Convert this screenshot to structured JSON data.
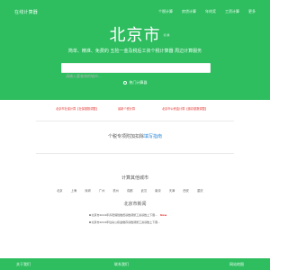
{
  "header": {
    "brand": "在线计算器",
    "nav": [
      "个税计算",
      "房贷计算",
      "年终奖",
      "工资计算",
      "更多"
    ]
  },
  "hero": {
    "title": "北京市",
    "title_suffix": "切换",
    "subtitle": "简单、精准、免费的 五险一金及税后工资个税计算器 周边计算服务",
    "search_placeholder": "请输入要查询的城市...",
    "tip": "热门计算器"
  },
  "promos": [
    "北京市社保计算【社保基数调整】",
    "最新个税计算",
    "北京市公积金计算【缴存基数调整】"
  ],
  "recent": {
    "text": "个税专项附加扣除",
    "link": "填写指南"
  },
  "other_cities": {
    "title": "计算其他城市",
    "cities": [
      "北京",
      "上海",
      "深圳",
      "广州",
      "杭州",
      "成都",
      "武汉",
      "南京",
      "天津",
      "西安",
      "重庆"
    ]
  },
  "news": {
    "title": "北京市新闻",
    "items": [
      {
        "text": "北京市2024年养老保险缴费基数调整工资基数上下限...",
        "badge": "New"
      },
      {
        "text": "北京市2024年住房公积金缴存基数调整工资基数上下限...",
        "badge": ""
      }
    ]
  },
  "footer": {
    "items": [
      "关于我们",
      "联系我们",
      "网站地图"
    ]
  },
  "colors": {
    "accent": "#2ebd5f",
    "link": "#2e8bd8",
    "alert": "#e53935"
  }
}
